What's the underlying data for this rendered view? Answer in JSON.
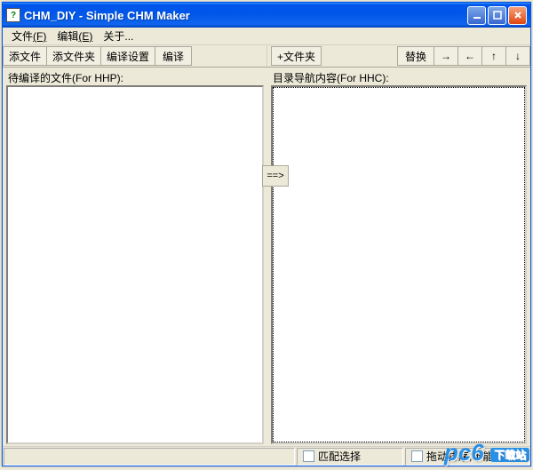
{
  "titlebar": {
    "title": "CHM_DIY - Simple CHM Maker"
  },
  "menu": {
    "file": "文件",
    "file_accel": "(F)",
    "edit": "编辑",
    "edit_accel": "(E)",
    "about": "关于..."
  },
  "toolbar": {
    "add_file": "添文件",
    "add_folder": "添文件夹",
    "compile_settings": "编译设置",
    "compile": "编译",
    "plus_folder": "+文件夹",
    "replace": "替换",
    "arrow_right": "→",
    "arrow_left": "←",
    "arrow_up": "↑",
    "arrow_down": "↓"
  },
  "panes": {
    "left_label": "待编译的文件(For HHP):",
    "right_label": "目录导航内容(For HHC):"
  },
  "mid_button": "==>",
  "status": {
    "match_select": "匹配选择",
    "drag_hint": "拖动排序,不能多选"
  },
  "watermark": {
    "main": "pc6",
    "sub": "下载站"
  }
}
